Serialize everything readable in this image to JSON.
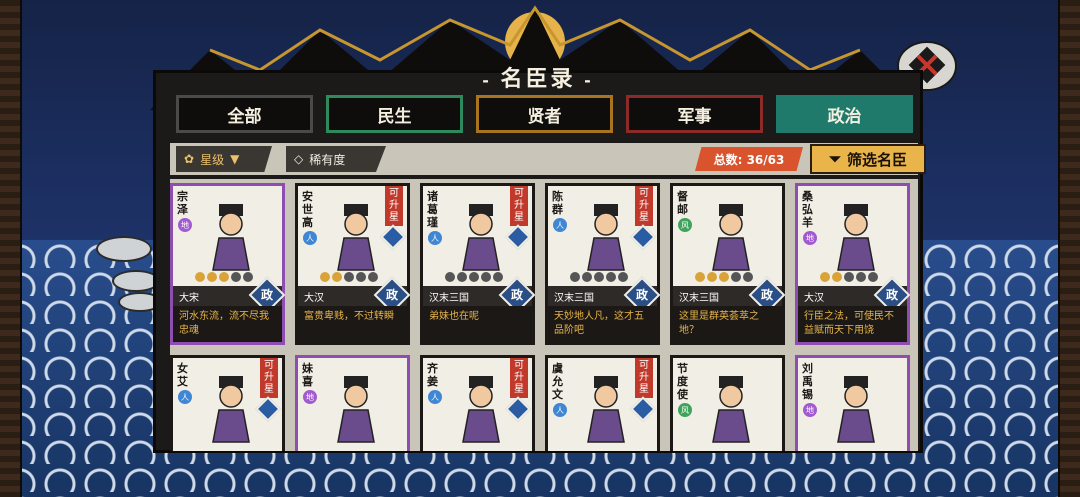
{
  "title": "名臣录",
  "tabs": [
    {
      "label": "全部",
      "border": "#4a4a4a"
    },
    {
      "label": "民生",
      "border": "#2e8a5c"
    },
    {
      "label": "贤者",
      "border": "#a8741e"
    },
    {
      "label": "军事",
      "border": "#8c2a2a"
    },
    {
      "label": "政治",
      "border": "#1f7a6b",
      "active": true
    }
  ],
  "filters": {
    "star_label": "星级",
    "rarity_label": "稀有度",
    "total": "总数: 36/63",
    "filter_button": "筛选名臣"
  },
  "upgrade_label": "可升星",
  "ministers_row1": [
    {
      "name": "宗泽",
      "tier": "地",
      "tier_class": "di",
      "stars": 3,
      "dynasty": "大宋",
      "role": "政",
      "quote": "河水东流，流不尽我忠魂",
      "upgrade": false,
      "purple": true
    },
    {
      "name": "安世高",
      "tier": "人",
      "tier_class": "ren",
      "stars": 2,
      "dynasty": "大汉",
      "role": "政",
      "quote": "富贵卑贱，不过转瞬",
      "upgrade": true,
      "purple": false
    },
    {
      "name": "诸葛瑾",
      "tier": "人",
      "tier_class": "ren",
      "stars": 0,
      "dynasty": "汉末三国",
      "role": "政",
      "quote": "弟妹也在呢",
      "upgrade": true,
      "purple": false
    },
    {
      "name": "陈群",
      "tier": "人",
      "tier_class": "ren",
      "stars": 0,
      "dynasty": "汉末三国",
      "role": "政",
      "quote": "天妙地人凡，这才五品阶吧",
      "upgrade": true,
      "purple": false
    },
    {
      "name": "督邮",
      "tier": "风",
      "tier_class": "feng",
      "stars": 3,
      "dynasty": "汉末三国",
      "role": "政",
      "quote": "这里是群英荟萃之地？",
      "upgrade": false,
      "purple": false
    },
    {
      "name": "桑弘羊",
      "tier": "地",
      "tier_class": "di",
      "stars": 2,
      "dynasty": "大汉",
      "role": "政",
      "quote": "行臣之法，可使民不益赋而天下用饶",
      "upgrade": false,
      "purple": true
    }
  ],
  "ministers_row2": [
    {
      "name": "女艾",
      "tier": "人",
      "tier_class": "ren",
      "upgrade": true,
      "purple": false
    },
    {
      "name": "妹喜",
      "tier": "地",
      "tier_class": "di",
      "upgrade": false,
      "purple": true
    },
    {
      "name": "齐姜",
      "tier": "人",
      "tier_class": "ren",
      "upgrade": true,
      "purple": false
    },
    {
      "name": "虞允文",
      "tier": "人",
      "tier_class": "ren",
      "upgrade": true,
      "purple": false
    },
    {
      "name": "节度使",
      "tier": "风",
      "tier_class": "feng",
      "upgrade": false,
      "purple": false
    },
    {
      "name": "刘禹锡",
      "tier": "地",
      "tier_class": "di",
      "upgrade": false,
      "purple": true
    }
  ]
}
